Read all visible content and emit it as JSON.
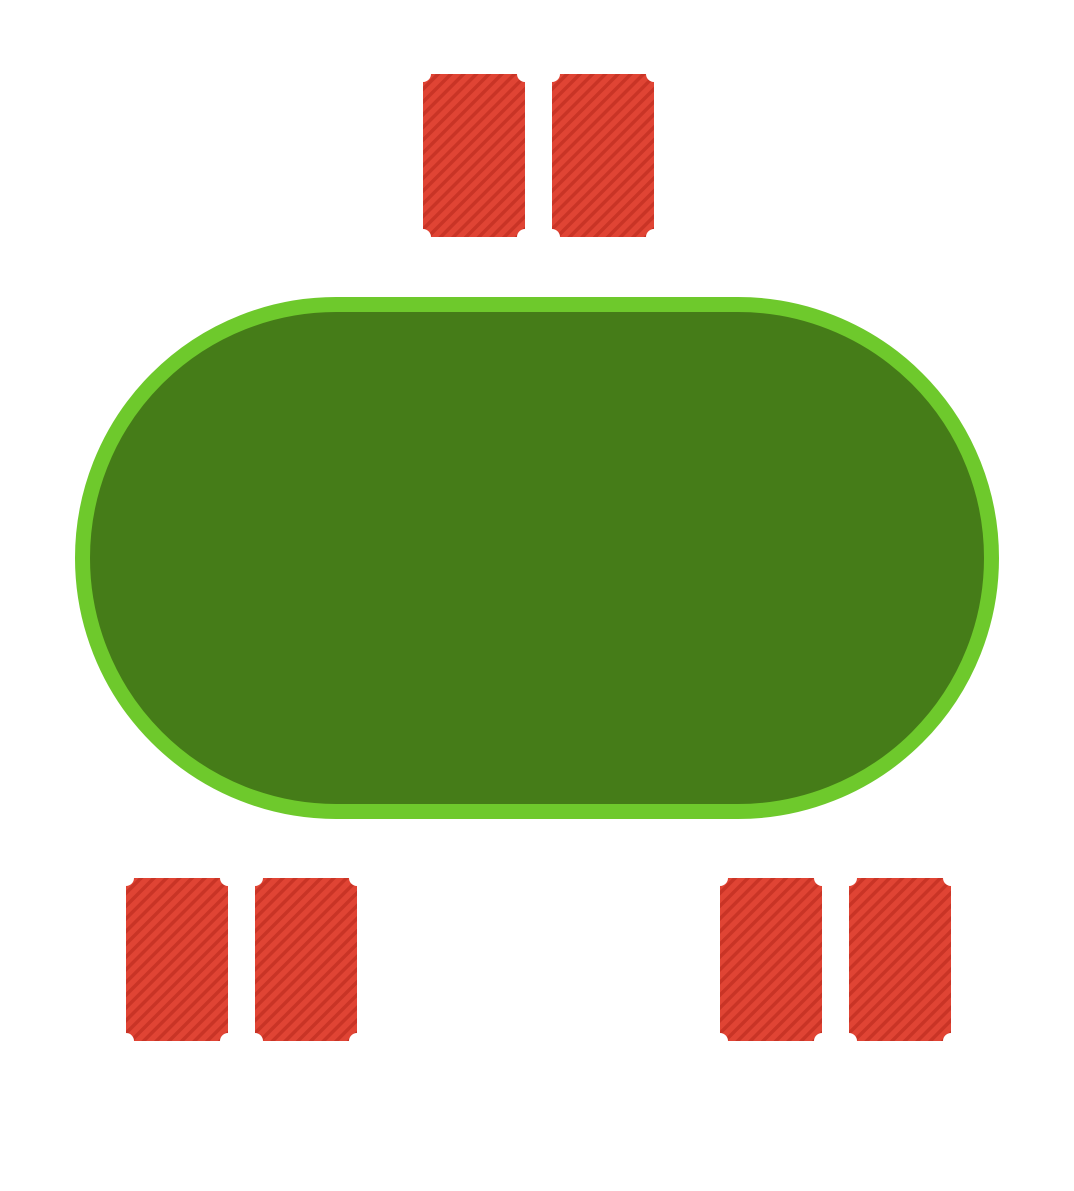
{
  "table": {
    "felt_color": "#457c18",
    "rim_color": "#6ec92c"
  },
  "card_back": {
    "base_color": "#e04434",
    "stripe_color": "#c93426",
    "icon": "card-back-icon"
  },
  "seats": [
    {
      "name": "seat-top",
      "cards_face_down": 2
    },
    {
      "name": "seat-bottom-left",
      "cards_face_down": 2
    },
    {
      "name": "seat-bottom-right",
      "cards_face_down": 2
    }
  ]
}
